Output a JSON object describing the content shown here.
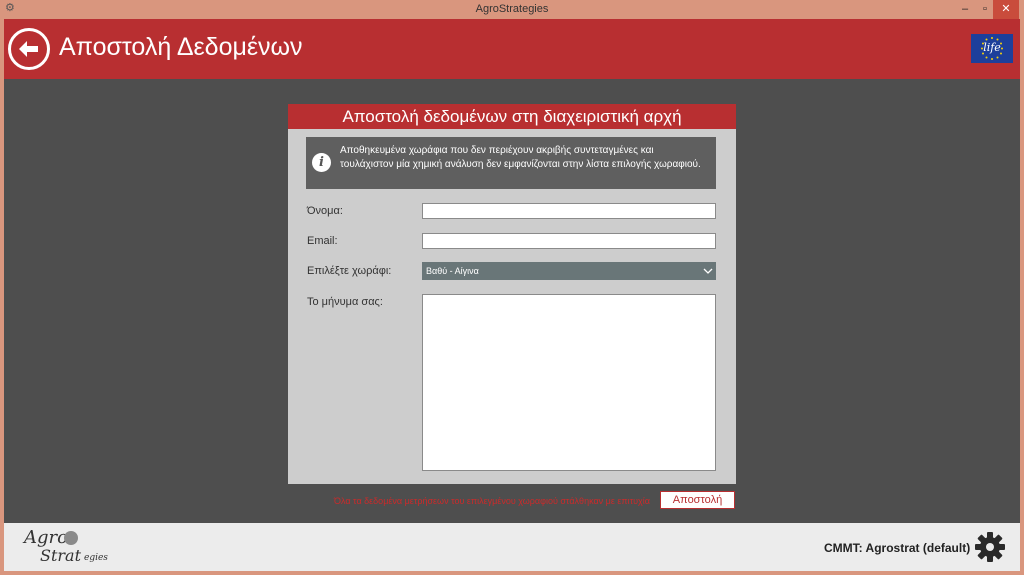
{
  "window": {
    "title": "AgroStrategies",
    "app_icon": "app-icon",
    "controls": {
      "minimize": "–",
      "maximize": "▫",
      "close": "✕"
    }
  },
  "header": {
    "title": "Αποστολή Δεδομένων",
    "back_icon": "back-arrow-icon",
    "eu_logo_text": "life"
  },
  "panel": {
    "title": "Αποστολή δεδομένων στη διαχειριστική αρχή",
    "info_icon": "info-icon",
    "info_text": "Αποθηκευμένα χωράφια που δεν περιέχουν ακριβής συντεταγμένες και τουλάχιστον μία χημική ανάλυση δεν εμφανίζονται στην λίστα επιλογής χωραφιού.",
    "fields": {
      "name_label": "Όνομα:",
      "name_value": "",
      "email_label": "Email:",
      "email_value": "",
      "field_label": "Επιλέξτε χωράφι:",
      "field_selected": "Βαθύ - Αίγινα",
      "message_label": "Το μήνυμα σας:",
      "message_value": ""
    }
  },
  "actions": {
    "status_message": "Όλα τα δεδομένα μετρήσεων του επιλεγμένου χωραφιού στάλθηκαν με επιτυχία",
    "send_label": "Αποστολή"
  },
  "footer": {
    "logo_agro": "Agro",
    "logo_strat": "Strat",
    "logo_egies": "egies",
    "cmmt_text": "CMMT: Agrostrat (default)",
    "settings_icon": "gear-icon"
  },
  "colors": {
    "accent": "#b82f31",
    "content_bg": "#4e4e4e",
    "panel_bg": "#cdcdcd",
    "window_border": "#d9967e"
  }
}
